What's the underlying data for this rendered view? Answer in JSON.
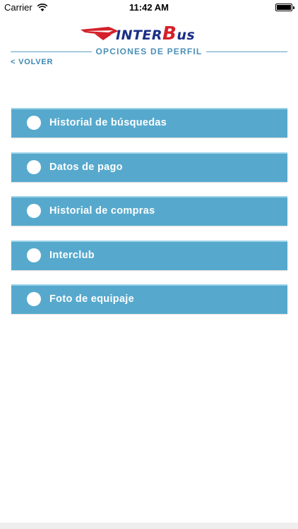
{
  "status_bar": {
    "carrier": "Carrier",
    "time": "11:42 AM"
  },
  "logo": {
    "part1": "INTER",
    "part2": "B",
    "part3": "us"
  },
  "header": {
    "title": "OPCIONES DE PERFIL",
    "back_label": "< VOLVER"
  },
  "menu": {
    "items": [
      {
        "label": "Historial de búsquedas"
      },
      {
        "label": "Datos de pago"
      },
      {
        "label": "Historial de compras"
      },
      {
        "label": "Interclub"
      },
      {
        "label": "Foto de equipaje"
      }
    ]
  },
  "colors": {
    "accent": "#56a9cd",
    "title_text": "#4a90b8",
    "logo_blue": "#1b2f86",
    "logo_red": "#d4212a"
  }
}
